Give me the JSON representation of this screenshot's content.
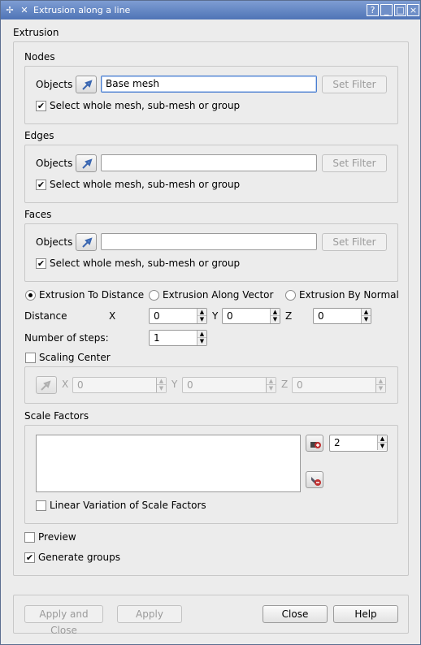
{
  "window": {
    "title": "Extrusion along a line",
    "buttons": {
      "help": "?",
      "minimize": "_",
      "maximize": "□",
      "close": "×"
    }
  },
  "section_title": "Extrusion",
  "nodes": {
    "title": "Nodes",
    "objects_label": "Objects",
    "value": "Base mesh",
    "set_filter": "Set Filter",
    "whole_mesh_label": "Select whole mesh, sub-mesh or group",
    "whole_mesh_checked": true
  },
  "edges": {
    "title": "Edges",
    "objects_label": "Objects",
    "value": "",
    "set_filter": "Set Filter",
    "whole_mesh_label": "Select whole mesh, sub-mesh or group",
    "whole_mesh_checked": true
  },
  "faces": {
    "title": "Faces",
    "objects_label": "Objects",
    "value": "",
    "set_filter": "Set Filter",
    "whole_mesh_label": "Select whole mesh, sub-mesh or group",
    "whole_mesh_checked": true
  },
  "mode": {
    "options": [
      "Extrusion To Distance",
      "Extrusion Along Vector",
      "Extrusion By Normal"
    ],
    "selected": "Extrusion To Distance"
  },
  "distance": {
    "label": "Distance",
    "x_label": "X",
    "x": "0",
    "y_label": "Y",
    "y": "0",
    "z_label": "Z",
    "z": "0"
  },
  "steps": {
    "label": "Number of steps:",
    "value": "1"
  },
  "scaling_center": {
    "label": "Scaling Center",
    "checked": false,
    "x_label": "X",
    "x": "0",
    "y_label": "Y",
    "y": "0",
    "z_label": "Z",
    "z": "0"
  },
  "scale_factors": {
    "title": "Scale Factors",
    "value": "2",
    "linear_variation_label": "Linear Variation of Scale Factors",
    "linear_variation_checked": false
  },
  "preview": {
    "label": "Preview",
    "checked": false
  },
  "generate_groups": {
    "label": "Generate groups",
    "checked": true
  },
  "footer": {
    "apply_close": "Apply and Close",
    "apply": "Apply",
    "close": "Close",
    "help": "Help"
  },
  "colors": {
    "titlebar": "#5b7fbf",
    "accent_focus": "#4a7ed0"
  }
}
